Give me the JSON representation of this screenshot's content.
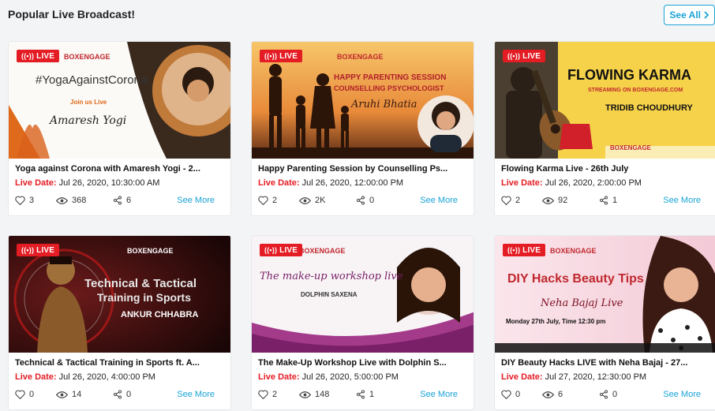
{
  "section": {
    "title": "Popular Live Broadcast!",
    "see_all": "See All"
  },
  "badge_label": "LIVE",
  "date_label": "Live Date:",
  "see_more": "See More",
  "cards": [
    {
      "title": "Yoga against Corona with Amaresh Yogi - 2...",
      "date": "Jul 26, 2020, 10:30:00 AM",
      "likes": "3",
      "views": "368",
      "shares": "6",
      "poster": {
        "heading": "#YogaAgainstCorona",
        "sub": "Join us Live",
        "name": "Amaresh Yogi",
        "brand": "BOXENGAGE"
      }
    },
    {
      "title": "Happy Parenting Session by Counselling Ps...",
      "date": "Jul 26, 2020, 12:00:00 PM",
      "likes": "2",
      "views": "2K",
      "shares": "0",
      "poster": {
        "heading": "HAPPY PARENTING SESSION",
        "sub": "COUNSELLING PSYCHOLOGIST",
        "name": "Aruhi Bhatia",
        "brand": "BOXENGAGE"
      }
    },
    {
      "title": "Flowing Karma Live - 26th July",
      "date": "Jul 26, 2020, 2:00:00 PM",
      "likes": "2",
      "views": "92",
      "shares": "1",
      "poster": {
        "heading": "FLOWING KARMA",
        "sub": "STREAMING ON BOXENGAGE.COM",
        "name": "TRIDIB CHOUDHURY",
        "brand": "BOXENGAGE"
      }
    },
    {
      "title": "Technical & Tactical Training in Sports ft. A...",
      "date": "Jul 26, 2020, 4:00:00 PM",
      "likes": "0",
      "views": "14",
      "shares": "0",
      "poster": {
        "heading": "Technical & Tactical",
        "sub": "Training in Sports",
        "name": "ANKUR CHHABRA",
        "brand": "BOXENGAGE"
      }
    },
    {
      "title": "The Make-Up Workshop Live with Dolphin S...",
      "date": "Jul 26, 2020, 5:00:00 PM",
      "likes": "2",
      "views": "148",
      "shares": "1",
      "poster": {
        "heading": "The make-up workshop live",
        "sub": "",
        "name": "DOLPHIN SAXENA",
        "brand": "BOXENGAGE"
      }
    },
    {
      "title": "DIY Beauty Hacks LIVE with Neha Bajaj - 27...",
      "date": "Jul 27, 2020, 12:30:00 PM",
      "likes": "0",
      "views": "6",
      "shares": "0",
      "poster": {
        "heading": "DIY Hacks Beauty Tips",
        "sub": "Monday 27th July, Time 12:30 pm",
        "name": "Neha Bajaj Live",
        "brand": "BOXENGAGE"
      }
    }
  ]
}
